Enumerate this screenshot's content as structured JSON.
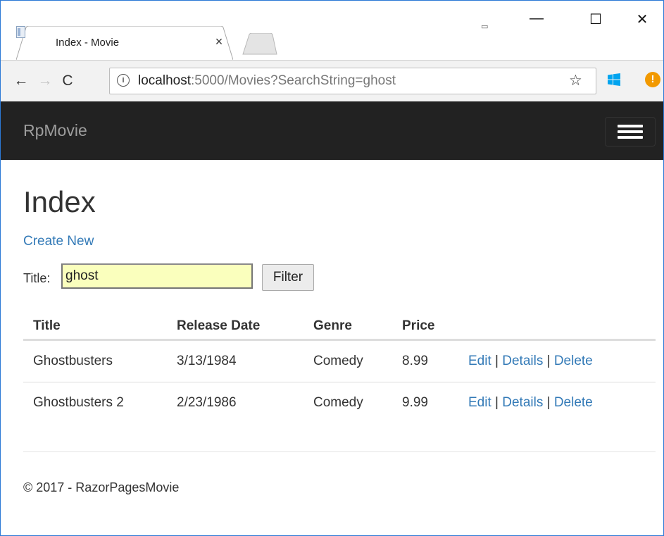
{
  "window": {
    "tab_title": "Index - Movie",
    "tab_close": "×",
    "minimize": "—",
    "maximize": "☐",
    "close": "✕",
    "restore_small": "▭"
  },
  "toolbar": {
    "back": "←",
    "forward": "→",
    "reload": "C",
    "info": "i",
    "url_host": "localhost",
    "url_rest": ":5000/Movies?SearchString=ghost",
    "star": "☆",
    "warn": "!"
  },
  "navbar": {
    "brand": "RpMovie"
  },
  "page": {
    "title": "Index",
    "create_link": "Create New",
    "search_label": "Title:",
    "search_value": "ghost",
    "filter_button": "Filter"
  },
  "table": {
    "headers": [
      "Title",
      "Release Date",
      "Genre",
      "Price"
    ],
    "rows": [
      {
        "title": "Ghostbusters",
        "release_date": "3/13/1984",
        "genre": "Comedy",
        "price": "8.99"
      },
      {
        "title": "Ghostbusters 2",
        "release_date": "2/23/1986",
        "genre": "Comedy",
        "price": "9.99"
      }
    ],
    "actions": {
      "edit": "Edit",
      "details": "Details",
      "delete": "Delete",
      "sep": "|"
    }
  },
  "footer": {
    "text": "© 2017 - RazorPagesMovie"
  },
  "colors": {
    "navbar_bg": "#222222",
    "link": "#337ab7",
    "autofill_bg": "#faffbd",
    "window_border": "#2b79d6"
  }
}
